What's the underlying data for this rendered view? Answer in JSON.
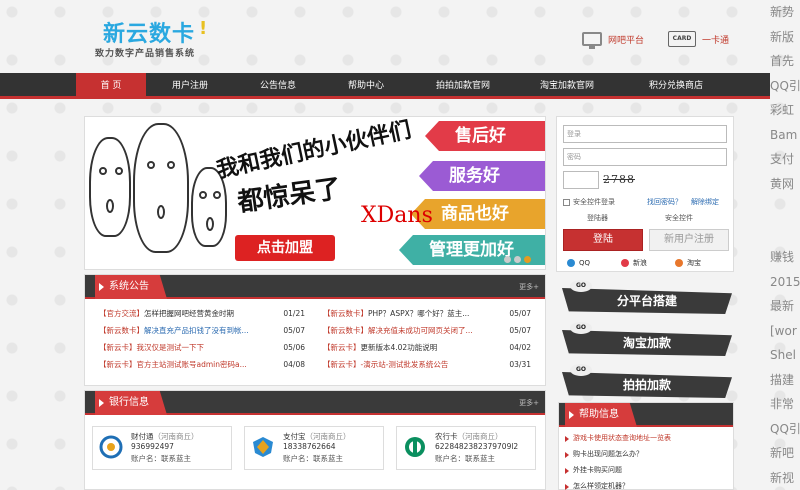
{
  "header": {
    "logo_text": "新云数卡",
    "logo_excl": "!",
    "slogan": "致力数字产品销售系统",
    "links": [
      {
        "label": "网吧平台"
      },
      {
        "label": "一卡通"
      }
    ],
    "card_icon_text": "CARD"
  },
  "nav": {
    "items": [
      {
        "label": "首 页"
      },
      {
        "label": "用户注册"
      },
      {
        "label": "公告信息"
      },
      {
        "label": "帮助中心"
      },
      {
        "label": "拍拍加款官网"
      },
      {
        "label": "淘宝加款官网"
      },
      {
        "label": "积分兑换商店"
      }
    ]
  },
  "banner": {
    "title_line1": "我和我们的小伙伴们",
    "title_line2": "都惊呆了",
    "tags": [
      "售后好",
      "服务好",
      "商品也好",
      "管理更加好"
    ],
    "join_label": "点击加盟",
    "watermark": "XDans",
    "slides": 3
  },
  "notices": {
    "title": "系统公告",
    "more": "更多+",
    "items": [
      {
        "tag": "【官方交流】",
        "text": "怎样把握网吧经营黄金时期",
        "date": "01/21"
      },
      {
        "tag": "【新云数卡】",
        "text": "PHP？ASPX？哪个好？蓝主...",
        "date": "05/07"
      },
      {
        "tag": "【新云数卡】",
        "text": "解决直充产品扣钱了没有到帐...",
        "date": "05/07"
      },
      {
        "tag": "【新云数卡】",
        "text": "解决充值未成功可网页关闭了...",
        "date": "05/07"
      },
      {
        "tag": "【新云卡】",
        "text": "我汉仅是测试一下下",
        "date": "05/06"
      },
      {
        "tag": "【新云卡】",
        "text": "更新版本4.02功能说明",
        "date": "04/02"
      },
      {
        "tag": "【新云卡】",
        "text": "官方主站测试账号admin密码a...",
        "date": "04/08"
      },
      {
        "tag": "【新云卡】",
        "text": "-演示站-测试批发系统公告",
        "date": "03/31"
      }
    ]
  },
  "bank": {
    "title": "银行信息",
    "more": "更多+",
    "items": [
      {
        "name": "财付通",
        "region": "（河南商丘）",
        "number": "936992497",
        "holder": "账户名：联系蓝主",
        "icon": "tenpay-icon",
        "color": "#1f6fb5"
      },
      {
        "name": "支付宝",
        "region": "（河南商丘）",
        "number": "18338762664",
        "holder": "账户名：联系蓝主",
        "icon": "alipay-icon",
        "color": "#e7a21c"
      },
      {
        "name": "农行卡",
        "region": "（河南商丘）",
        "number": "6228482382379709l2",
        "holder": "账户名：联系蓝主",
        "icon": "abc-bank-icon",
        "color": "#0a8f5f"
      }
    ]
  },
  "login": {
    "account_placeholder": "登录",
    "password_placeholder": "密码",
    "captcha_text": "2788",
    "safe_control": "安全控件登录",
    "find_password": "找回密码？",
    "unbind": "解除绑定",
    "login_type": "登陆器",
    "secure_control": "安全控件",
    "login_button": "登陆",
    "register_button": "新用户注册",
    "social": [
      "QQ",
      "新浪",
      "淘宝"
    ]
  },
  "promos": [
    {
      "label": "分平台搭建",
      "go": "GO"
    },
    {
      "label": "淘宝加款",
      "go": "GO"
    },
    {
      "label": "拍拍加款",
      "go": "GO"
    }
  ],
  "help": {
    "title": "帮助信息",
    "items": [
      {
        "text": "游戏卡使用状态查询地址一览表",
        "color": "#c0392b"
      },
      {
        "text": "购卡出现问题怎么办？",
        "color": "#333"
      },
      {
        "text": "外挂卡购买问题",
        "color": "#333"
      },
      {
        "text": "怎么样领定机器？",
        "color": "#333"
      }
    ]
  },
  "right_edge": [
    "新势",
    "新版",
    "首先",
    "QQ引",
    "彩虹",
    "Bam",
    "支付",
    "黄网",
    "",
    "",
    "赚钱",
    "2015",
    "最新",
    "[wor",
    "Shel",
    "描建",
    "非常",
    "QQ引",
    "新吧",
    "新视"
  ],
  "colors": {
    "accent": "#c63131",
    "nav_bg": "#333333"
  }
}
